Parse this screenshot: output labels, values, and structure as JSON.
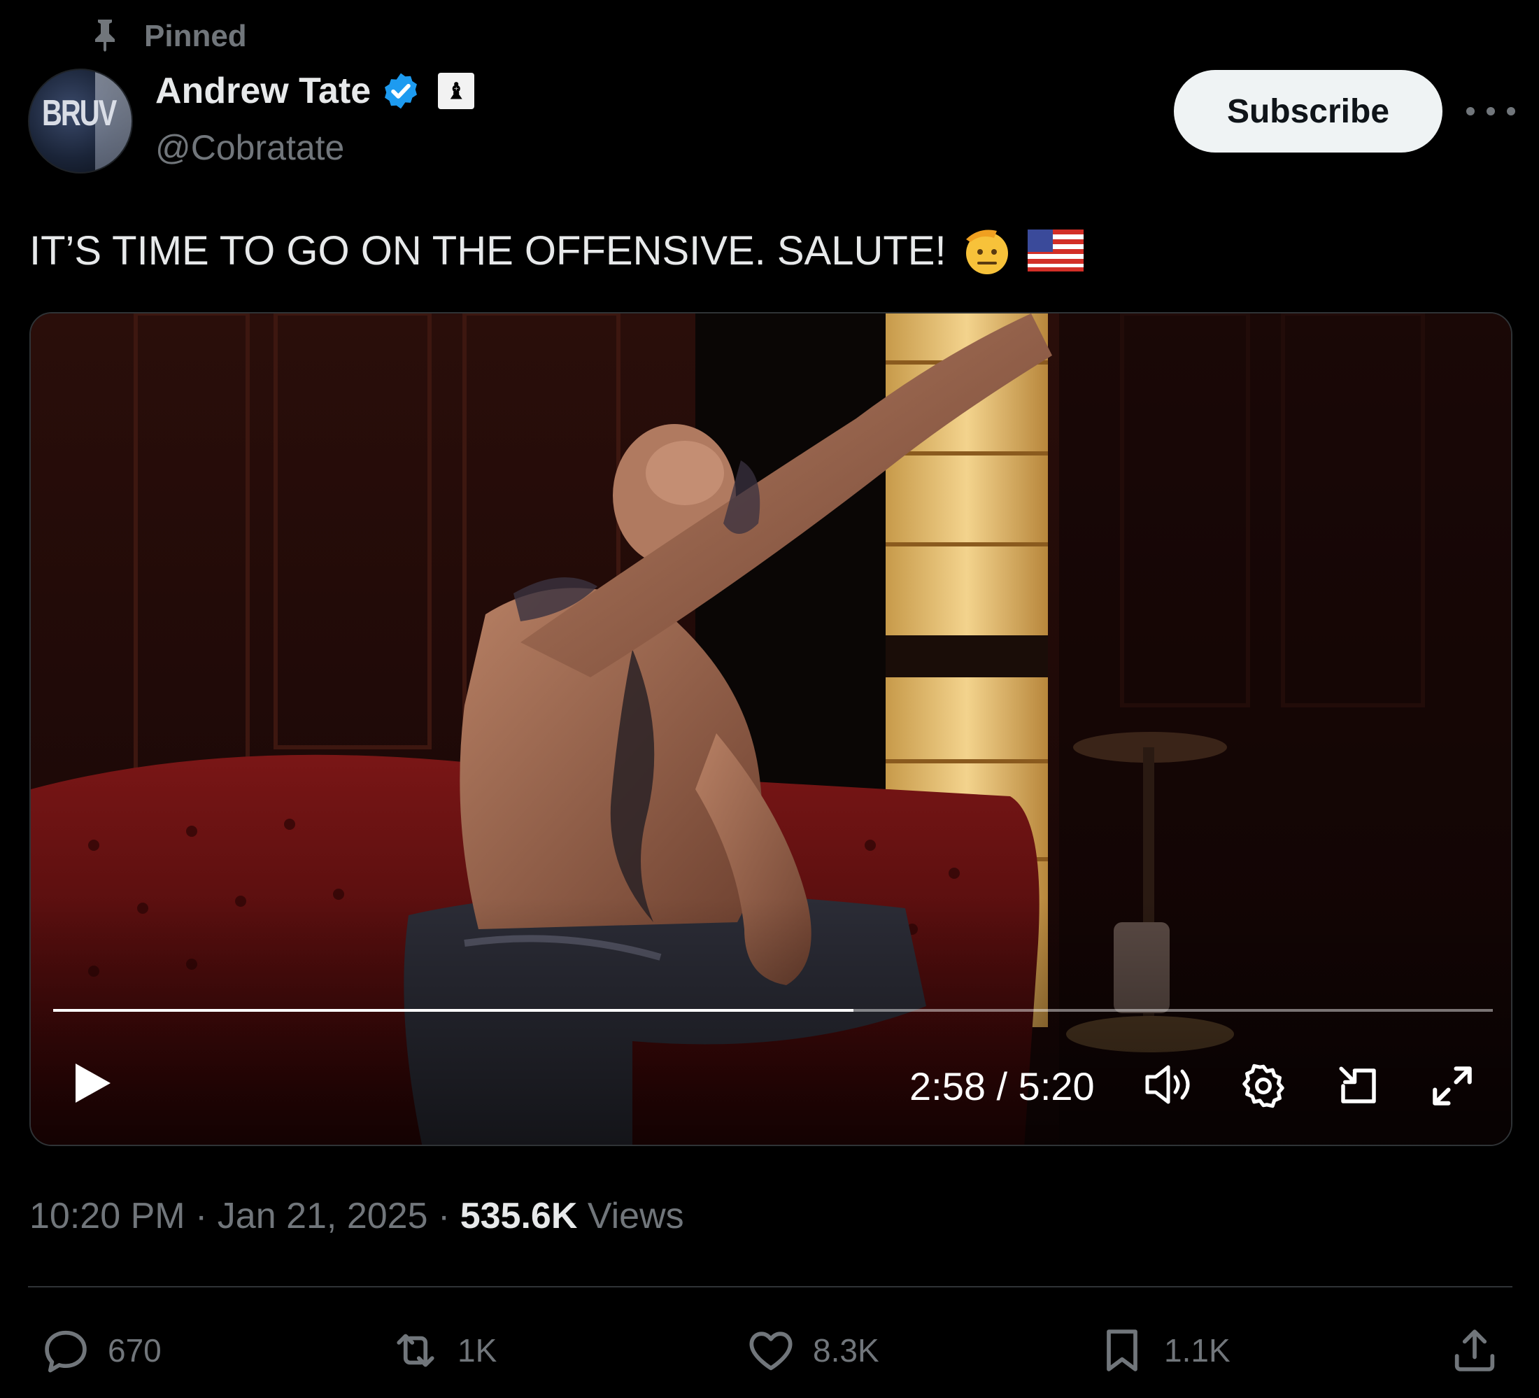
{
  "pinned": {
    "label": "Pinned",
    "icon": "pin-icon"
  },
  "author": {
    "display_name": "Andrew Tate",
    "handle": "@Cobratate",
    "avatar_text": "BRUV",
    "verified_icon": "verified-badge-icon",
    "affiliate_icon": "affiliate-badge-icon",
    "affiliate_glyph": "♝"
  },
  "header": {
    "subscribe_label": "Subscribe",
    "more_icon": "more-icon"
  },
  "tweet": {
    "text": "IT’S TIME TO GO ON THE OFFENSIVE. SALUTE!",
    "emojis": [
      "saluting-face-emoji",
      "us-flag-emoji"
    ]
  },
  "video": {
    "time_display": "2:58 / 5:20",
    "progress": 0.556,
    "controls": [
      "play-icon",
      "volume-icon",
      "settings-icon",
      "pip-icon",
      "fullscreen-icon"
    ]
  },
  "meta": {
    "time": "10:20 PM",
    "separator": " · ",
    "date": "Jan 21, 2025",
    "views_count": "535.6K",
    "views_label": " Views"
  },
  "actions": {
    "replies": "670",
    "reposts": "1K",
    "likes": "8.3K",
    "bookmarks": "1.1K"
  },
  "colors": {
    "background": "#000000",
    "primary_text": "#e7e9ea",
    "secondary_text": "#71767b",
    "verified_blue": "#1d9bf0",
    "divider": "#2f3336"
  }
}
